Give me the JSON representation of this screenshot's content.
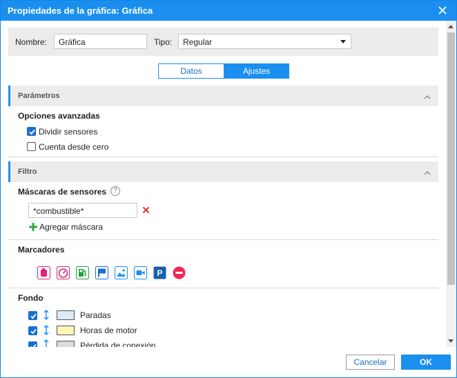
{
  "dialog": {
    "title": "Propiedades de la gráfica: Gráfica",
    "name_label": "Nombre:",
    "name_value": "Gráfica",
    "type_label": "Tipo:",
    "type_value": "Regular",
    "tabs": [
      {
        "label": "Datos",
        "active": false
      },
      {
        "label": "Ajustes",
        "active": true
      }
    ]
  },
  "parametros": {
    "header": "Parámetros",
    "subtitle": "Opciones avanzadas",
    "options": [
      {
        "label": "Dividir sensores",
        "checked": true
      },
      {
        "label": "Cuenta desde cero",
        "checked": false
      }
    ]
  },
  "filtro": {
    "header": "Filtro",
    "masks_title": "Máscaras de sensores",
    "help_glyph": "?",
    "mask_value": "*combustible*",
    "add_mask_label": "Agregar máscara",
    "markers_title": "Marcadores",
    "markers": [
      {
        "icon": "fuel-tank-icon",
        "color": "#e0207a"
      },
      {
        "icon": "gauge-icon",
        "color": "#e0207a"
      },
      {
        "icon": "fuel-pump-icon",
        "color": "#1fa03a"
      },
      {
        "icon": "flag-icon",
        "color": "#1a6fd0"
      },
      {
        "icon": "image-icon",
        "color": "#1a8ff0"
      },
      {
        "icon": "video-icon",
        "color": "#1a8ff0"
      },
      {
        "icon": "parking-icon",
        "color": "#1a5fb0"
      },
      {
        "icon": "no-entry-icon",
        "color": "#f0285a"
      }
    ],
    "background_title": "Fondo",
    "backgrounds": [
      {
        "label": "Paradas",
        "checked": true,
        "color": "#dbeaf7"
      },
      {
        "label": "Horas de motor",
        "checked": true,
        "color": "#fff3b8"
      },
      {
        "label": "Pérdida de conexión",
        "checked": true,
        "color": "#dcdcdc"
      }
    ]
  },
  "footer": {
    "cancel_label": "Cancelar",
    "ok_label": "OK"
  },
  "colors": {
    "accent": "#1a8ff0",
    "delete": "#e03030",
    "add": "#2fa83a"
  }
}
